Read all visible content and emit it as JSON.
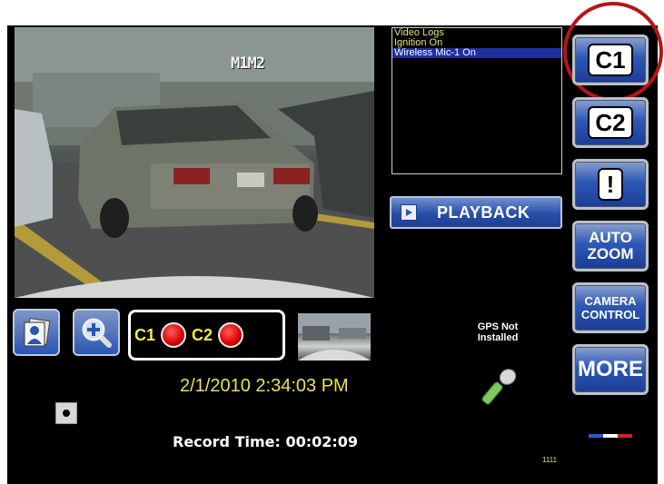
{
  "video": {
    "overlay_label": "M1M2"
  },
  "log": {
    "items": [
      {
        "label": "Video Logs",
        "selected": false
      },
      {
        "label": "Ignition On",
        "selected": false
      },
      {
        "label": "Wireless Mic-1 On",
        "selected": true
      }
    ]
  },
  "playback": {
    "label": "PLAYBACK",
    "icon": "play-icon"
  },
  "right_buttons": {
    "c1": "C1",
    "c2": "C2",
    "alert": "!",
    "auto_zoom": [
      "AUTO",
      "ZOOM"
    ],
    "camera_control": [
      "CAMERA",
      "CONTROL"
    ],
    "more": "MORE"
  },
  "tools": {
    "snapshot_icon": "photo-icon",
    "zoom_icon": "magnify-plus-icon"
  },
  "recording": {
    "c1": "C1",
    "c2": "C2",
    "status_color": "#d80000"
  },
  "gps": {
    "line1": "GPS Not",
    "line2": "Installed"
  },
  "datetime": "2/1/2010 2:34:03 PM",
  "record_time": "Record Time: 00:02:09",
  "unit_code": "1111",
  "colors": {
    "accent_blue": "#2d58b6",
    "highlight_ring": "#b81414",
    "text_yellow": "#e8e34a"
  }
}
